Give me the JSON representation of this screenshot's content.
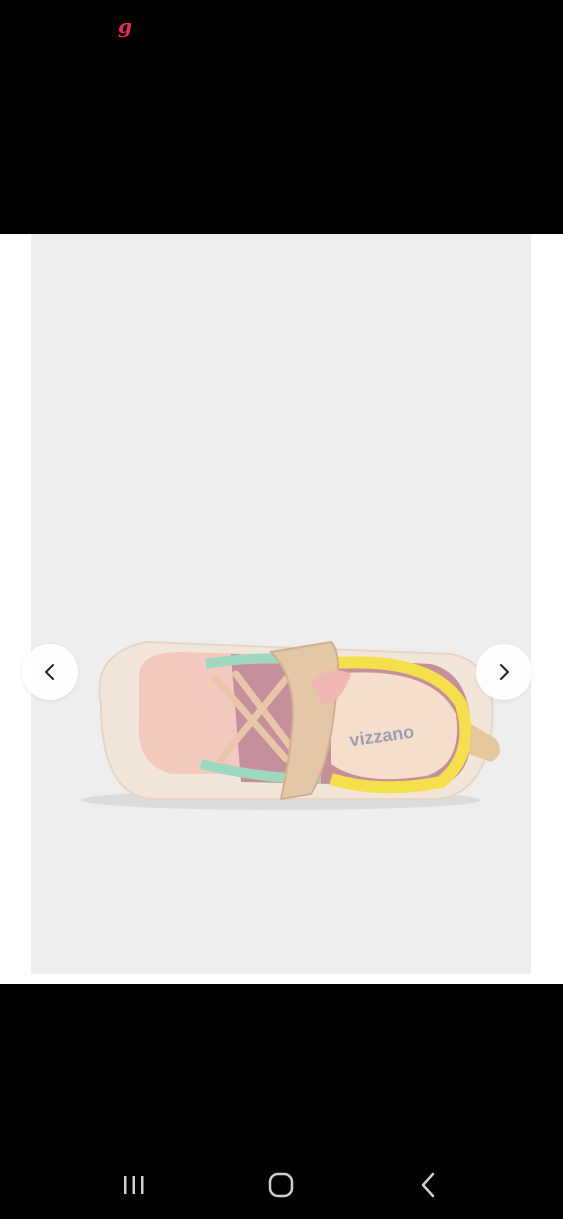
{
  "status_bar": {
    "app_mark": "g",
    "app_mark_color": "#e6275a"
  },
  "gallery": {
    "image": {
      "description_icon": "sneaker-product-photo",
      "brand_text": "vizzano",
      "background": "#eeeeee"
    },
    "prev_icon": "chevron-left-icon",
    "next_icon": "chevron-right-icon"
  },
  "system_nav": {
    "recents_icon": "recents-icon",
    "home_icon": "home-icon",
    "back_icon": "back-icon"
  }
}
